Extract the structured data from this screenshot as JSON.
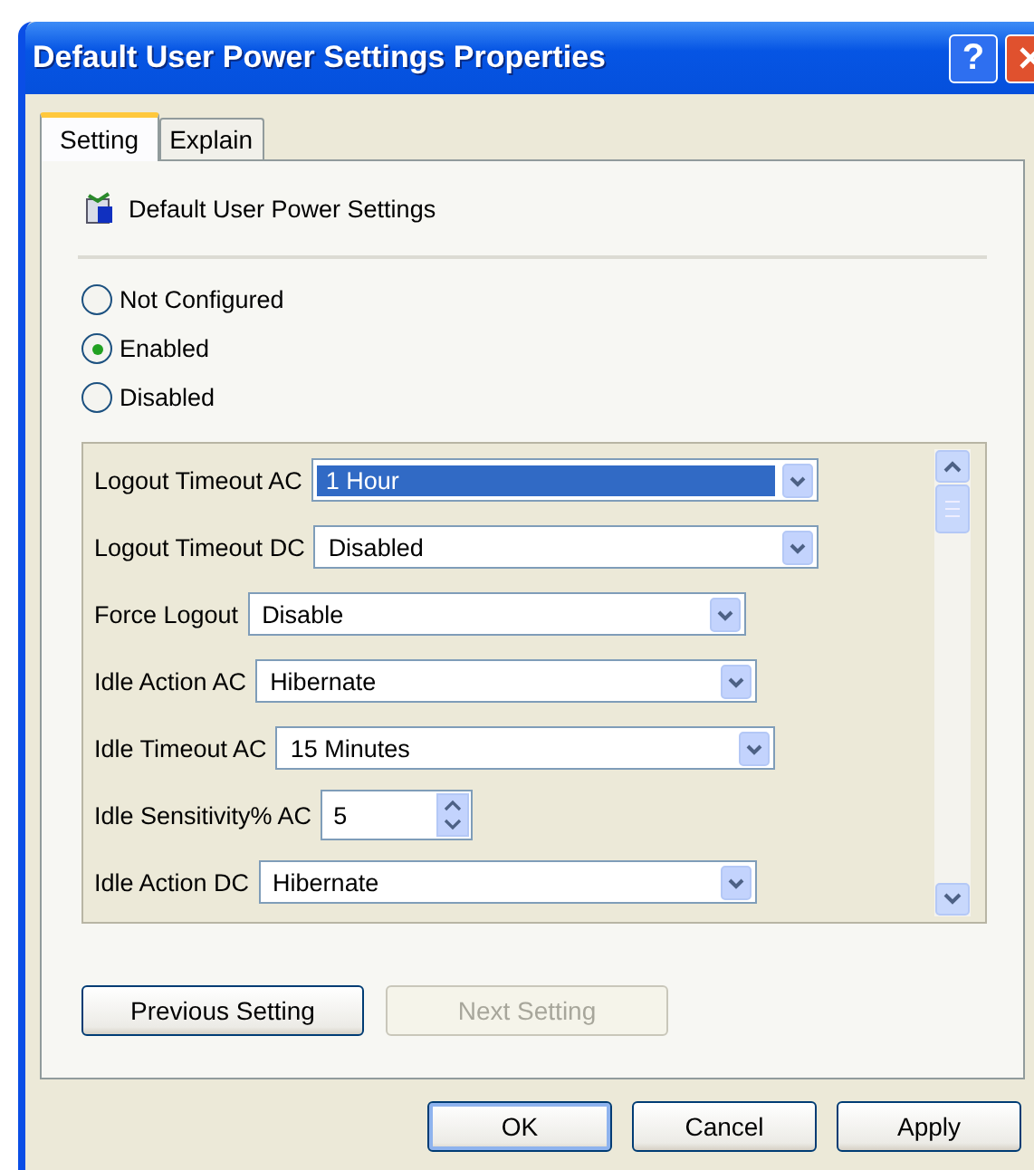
{
  "window": {
    "title": "Default User Power Settings Properties",
    "help_button": "?"
  },
  "tabs": [
    {
      "label": "Setting",
      "selected": true
    },
    {
      "label": "Explain",
      "selected": false
    }
  ],
  "policy": {
    "name": "Default User Power Settings"
  },
  "options": [
    {
      "label": "Not Configured",
      "selected": false
    },
    {
      "label": "Enabled",
      "selected": true
    },
    {
      "label": "Disabled",
      "selected": false
    }
  ],
  "settings": [
    {
      "kind": "dropdown",
      "label": "Logout Timeout AC",
      "value": "1 Hour",
      "selected": true
    },
    {
      "kind": "dropdown",
      "label": "Logout Timeout DC",
      "value": "Disabled",
      "selected": false
    },
    {
      "kind": "dropdown",
      "label": "Force Logout",
      "value": "Disable",
      "selected": false
    },
    {
      "kind": "dropdown",
      "label": "Idle Action AC",
      "value": "Hibernate",
      "selected": false
    },
    {
      "kind": "dropdown",
      "label": "Idle Timeout AC",
      "value": "15 Minutes",
      "selected": false
    },
    {
      "kind": "spinner",
      "label": "Idle Sensitivity% AC",
      "value": "5",
      "selected": false
    },
    {
      "kind": "dropdown",
      "label": "Idle Action DC",
      "value": "Hibernate",
      "selected": false
    }
  ],
  "navigation": [
    {
      "label": "Previous Setting",
      "disabled": false
    },
    {
      "label": "Next Setting",
      "disabled": true
    }
  ],
  "buttons": [
    "OK",
    "Cancel",
    "Apply"
  ]
}
